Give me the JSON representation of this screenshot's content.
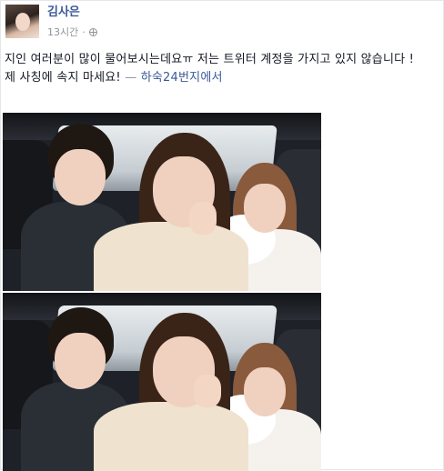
{
  "post": {
    "author_name": "김사은",
    "timestamp": "13시간",
    "separator": "·",
    "privacy_icon": "globe-icon",
    "text_line1": "지인 여러분이 많이 물어보시는데요ㅠ 저는 트위터 계정을 가지고 있지 않습니다 !",
    "text_line2_main": "제 사칭에 속지 마세요!",
    "text_line2_sep": " — ",
    "text_line2_place": "하숙24번지에서",
    "photos": [
      {
        "alt": "selfie photo 1"
      },
      {
        "alt": "selfie photo 2"
      }
    ]
  },
  "colors": {
    "link": "#3b5998",
    "meta": "#90949c",
    "text": "#141823"
  }
}
